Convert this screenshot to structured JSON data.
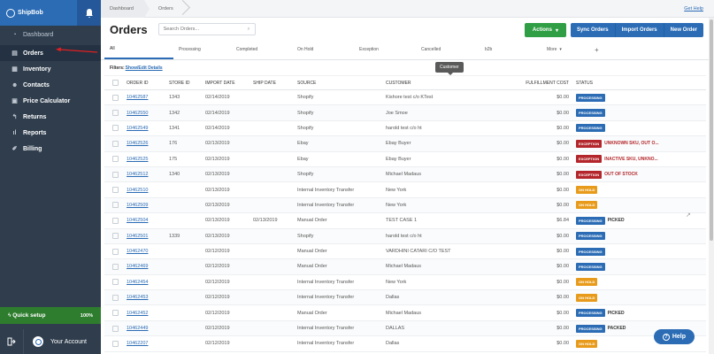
{
  "sidebar": {
    "brand": "ShipBob",
    "items": [
      {
        "label": "Dashboard",
        "icon": "dashboard-icon"
      },
      {
        "label": "Orders",
        "icon": "orders-icon"
      },
      {
        "label": "Inventory",
        "icon": "inventory-icon"
      },
      {
        "label": "Contacts",
        "icon": "contacts-icon"
      },
      {
        "label": "Price Calculator",
        "icon": "calculator-icon"
      },
      {
        "label": "Returns",
        "icon": "returns-icon"
      },
      {
        "label": "Reports",
        "icon": "reports-icon"
      },
      {
        "label": "Billing",
        "icon": "billing-icon"
      }
    ],
    "quick_setup": {
      "label": "Quick setup",
      "percent": "100%"
    },
    "account_label": "Your Account"
  },
  "topbar": {
    "breadcrumbs": [
      "Dashboard",
      "Orders"
    ],
    "help_link": "Get Help"
  },
  "header": {
    "title": "Orders",
    "search_placeholder": "Search Orders...",
    "actions_label": "Actions",
    "buttons": [
      "Sync Orders",
      "Import Orders",
      "New Order"
    ]
  },
  "tabs": [
    "All",
    "Processing",
    "Completed",
    "On Hold",
    "Exception",
    "Cancelled",
    "b2b",
    "More"
  ],
  "tooltip": "Customer",
  "filters": {
    "label": "Filters:",
    "link": "Show/Edit Details"
  },
  "table": {
    "columns": [
      "ORDER ID",
      "STORE ID",
      "IMPORT DATE",
      "SHIP DATE",
      "SOURCE",
      "CUSTOMER",
      "FULFILLMENT COST",
      "STATUS"
    ],
    "rows": [
      {
        "order_id": "10462587",
        "store_id": "1343",
        "import_date": "02/14/2019",
        "ship_date": "",
        "source": "Shopify",
        "customer": "Kishore test c/o KTest",
        "cost": "$0.00",
        "status": "PROCESSING",
        "note": ""
      },
      {
        "order_id": "10462550",
        "store_id": "1342",
        "import_date": "02/14/2019",
        "ship_date": "",
        "source": "Shopify",
        "customer": "Joe Smoe",
        "cost": "$0.00",
        "status": "PROCESSING",
        "note": ""
      },
      {
        "order_id": "10462549",
        "store_id": "1341",
        "import_date": "02/14/2019",
        "ship_date": "",
        "source": "Shopify",
        "customer": "harold test c/o ht",
        "cost": "$0.00",
        "status": "PROCESSING",
        "note": ""
      },
      {
        "order_id": "10462526",
        "store_id": "176",
        "import_date": "02/13/2019",
        "ship_date": "",
        "source": "Ebay",
        "customer": "Ebay Buyer",
        "cost": "$0.00",
        "status": "EXCEPTION",
        "note": "UNKNOWN SKU, OUT O..."
      },
      {
        "order_id": "10462525",
        "store_id": "175",
        "import_date": "02/13/2019",
        "ship_date": "",
        "source": "Ebay",
        "customer": "Ebay Buyer",
        "cost": "$0.00",
        "status": "EXCEPTION",
        "note": "INACTIVE SKU, UNKNO..."
      },
      {
        "order_id": "10462512",
        "store_id": "1340",
        "import_date": "02/13/2019",
        "ship_date": "",
        "source": "Shopify",
        "customer": "Michael Madaus",
        "cost": "$0.00",
        "status": "EXCEPTION",
        "note": "OUT OF STOCK"
      },
      {
        "order_id": "10462510",
        "store_id": "",
        "import_date": "02/13/2019",
        "ship_date": "",
        "source": "Internal Inventory Transfer",
        "customer": "New York",
        "cost": "$0.00",
        "status": "ON HOLD",
        "note": ""
      },
      {
        "order_id": "10462509",
        "store_id": "",
        "import_date": "02/13/2019",
        "ship_date": "",
        "source": "Internal Inventory Transfer",
        "customer": "New York",
        "cost": "$0.00",
        "status": "ON HOLD",
        "note": ""
      },
      {
        "order_id": "10462504",
        "store_id": "",
        "import_date": "02/13/2019",
        "ship_date": "02/13/2019",
        "source": "Manual Order",
        "customer": "TEST CASE 1",
        "cost": "$6.84",
        "status": "PROCESSING",
        "note": "PICKED"
      },
      {
        "order_id": "10462501",
        "store_id": "1339",
        "import_date": "02/13/2019",
        "ship_date": "",
        "source": "Shopify",
        "customer": "harold test c/o ht",
        "cost": "$0.00",
        "status": "PROCESSING",
        "note": ""
      },
      {
        "order_id": "10462470",
        "store_id": "",
        "import_date": "02/12/2019",
        "ship_date": "",
        "source": "Manual Order",
        "customer": "VARDHINI CATARI C/O TEST",
        "cost": "$0.00",
        "status": "PROCESSING",
        "note": ""
      },
      {
        "order_id": "10462469",
        "store_id": "",
        "import_date": "02/12/2019",
        "ship_date": "",
        "source": "Manual Order",
        "customer": "Michael Madaus",
        "cost": "$0.00",
        "status": "PROCESSING",
        "note": ""
      },
      {
        "order_id": "10462454",
        "store_id": "",
        "import_date": "02/12/2019",
        "ship_date": "",
        "source": "Internal Inventory Transfer",
        "customer": "New York",
        "cost": "$0.00",
        "status": "ON HOLD",
        "note": ""
      },
      {
        "order_id": "10462453",
        "store_id": "",
        "import_date": "02/12/2019",
        "ship_date": "",
        "source": "Internal Inventory Transfer",
        "customer": "Dallas",
        "cost": "$0.00",
        "status": "ON HOLD",
        "note": ""
      },
      {
        "order_id": "10462452",
        "store_id": "",
        "import_date": "02/12/2019",
        "ship_date": "",
        "source": "Manual Order",
        "customer": "Michael Madaus",
        "cost": "$0.00",
        "status": "PROCESSING",
        "note": "PICKED"
      },
      {
        "order_id": "10462449",
        "store_id": "",
        "import_date": "02/12/2019",
        "ship_date": "",
        "source": "Internal Inventory Transfer",
        "customer": "DALLAS",
        "cost": "$0.00",
        "status": "PROCESSING",
        "note": "PACKED"
      },
      {
        "order_id": "10462207",
        "store_id": "",
        "import_date": "02/12/2019",
        "ship_date": "",
        "source": "Internal Inventory Transfer",
        "customer": "Dallas",
        "cost": "$0.00",
        "status": "ON HOLD",
        "note": ""
      }
    ]
  },
  "status_colors": {
    "PROCESSING": "#2b6cb5",
    "EXCEPTION": "#b3262b",
    "ON HOLD": "#e89b1a"
  },
  "help_button": "Help"
}
